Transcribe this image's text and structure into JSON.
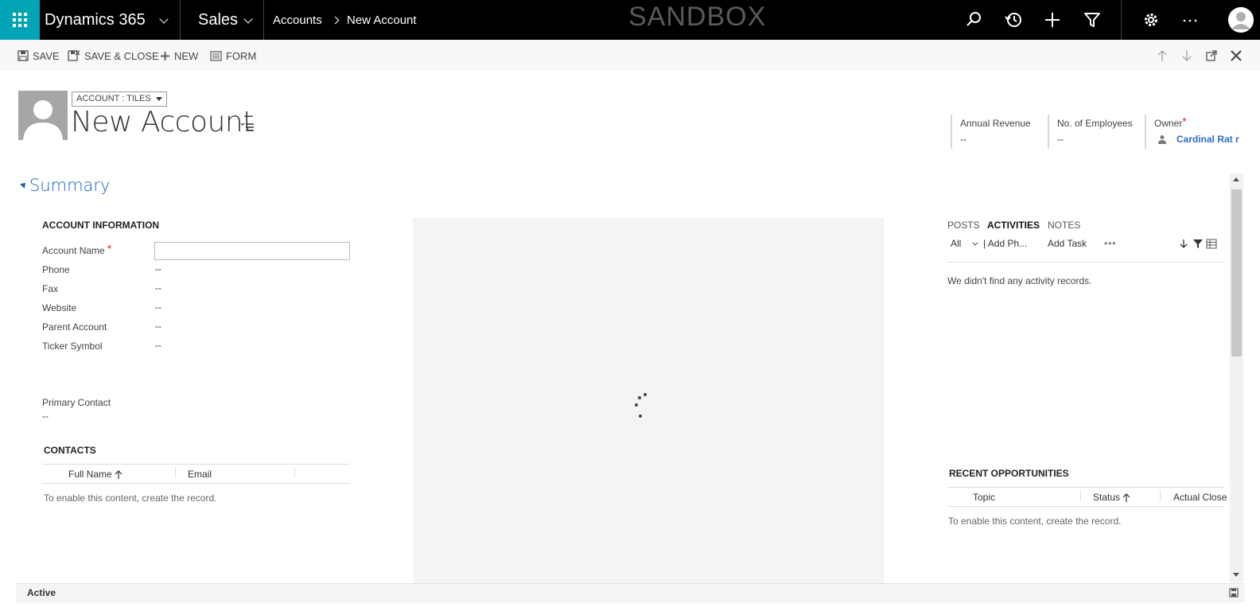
{
  "topbar": {
    "app_title": "Dynamics 365",
    "module": "Sales",
    "breadcrumb": [
      "Accounts",
      "New Account"
    ],
    "environment_badge": "SANDBOX",
    "icons": [
      "search-icon",
      "recent-icon",
      "new-icon",
      "advanced-find-icon",
      "settings-icon",
      "more-icon",
      "user-avatar"
    ]
  },
  "commands": {
    "save": "SAVE",
    "save_close": "SAVE & CLOSE",
    "new": "NEW",
    "form": "FORM"
  },
  "header": {
    "form_selector": "ACCOUNT : TILES",
    "title": "New Account",
    "fields": [
      {
        "label": "Annual Revenue",
        "value": "--"
      },
      {
        "label": "No. of Employees",
        "value": "--"
      },
      {
        "label": "Owner",
        "value": "Cardinal Rat r",
        "required": "*"
      }
    ]
  },
  "summary": {
    "title": "Summary",
    "account_info": {
      "heading": "ACCOUNT INFORMATION",
      "account_name_label": "Account Name",
      "required_mark": "*",
      "account_name_value": "",
      "fields": [
        {
          "label": "Phone",
          "value": "--"
        },
        {
          "label": "Fax",
          "value": "--"
        },
        {
          "label": "Website",
          "value": "--"
        },
        {
          "label": "Parent Account",
          "value": "--"
        },
        {
          "label": "Ticker Symbol",
          "value": "--"
        }
      ],
      "primary_contact_label": "Primary Contact",
      "primary_contact_value": "--"
    },
    "contacts": {
      "heading": "CONTACTS",
      "columns": [
        "Full Name",
        "Email"
      ],
      "empty": "To enable this content, create the record."
    },
    "timeline": {
      "tabs": [
        "POSTS",
        "ACTIVITIES",
        "NOTES"
      ],
      "active_tab": "ACTIVITIES",
      "filter": "All",
      "add_phone": "| Add Ph...",
      "add_task": "Add Task",
      "more": "•••",
      "empty": "We didn't find any activity records."
    },
    "opportunities": {
      "heading": "RECENT OPPORTUNITIES",
      "columns": [
        "Topic",
        "Status",
        "Actual Close"
      ],
      "empty": "To enable this content, create the record."
    }
  },
  "footer": {
    "status": "Active"
  },
  "colors": {
    "nav_bg": "#000000",
    "waffle_bg": "#00a4b4",
    "accent_blue": "#1f61b3",
    "link_blue": "#2c6fc7",
    "required_red": "#e00000"
  }
}
